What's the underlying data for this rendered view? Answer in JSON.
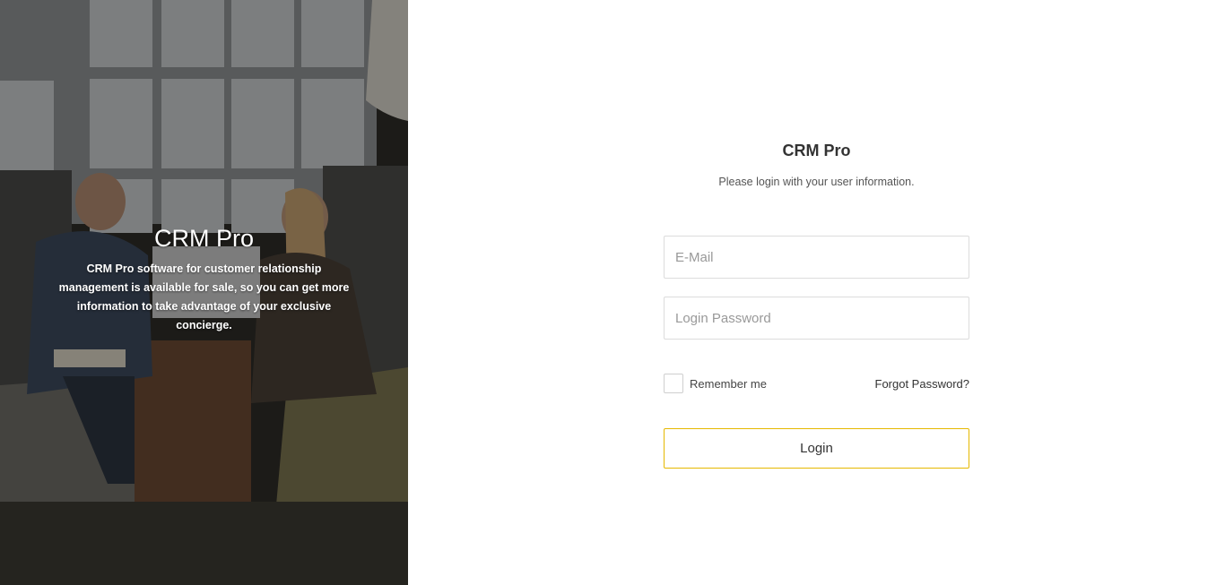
{
  "hero": {
    "title": "CRM Pro",
    "description": "CRM Pro software for customer relationship management is available for sale, so you can get more information to take advantage of your exclusive concierge."
  },
  "login": {
    "title": "CRM Pro",
    "subtitle": "Please login with your user information.",
    "email_placeholder": "E-Mail",
    "password_placeholder": "Login Password",
    "remember_label": "Remember me",
    "forgot_label": "Forgot Password?",
    "button_label": "Login"
  },
  "colors": {
    "accent_border": "#e6b800",
    "text": "#333333",
    "field_border": "#dcdcdc"
  }
}
